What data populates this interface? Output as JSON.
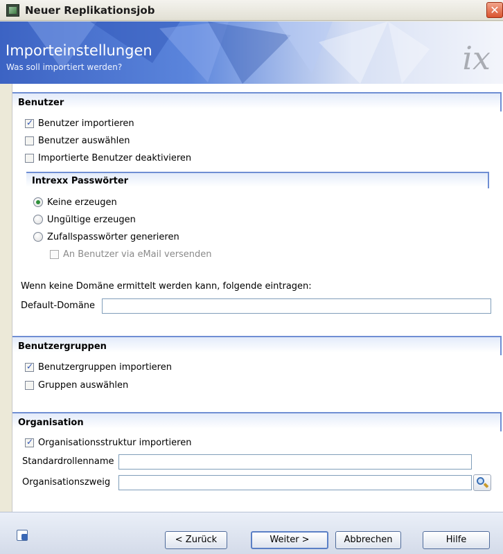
{
  "window": {
    "title": "Neuer Replikationsjob",
    "close_glyph": "✕"
  },
  "banner": {
    "title": "Importeinstellungen",
    "subtitle": "Was soll importiert werden?",
    "logo_text": "ix"
  },
  "benutzer": {
    "header": "Benutzer",
    "items": [
      {
        "label": "Benutzer importieren",
        "checked": true
      },
      {
        "label": "Benutzer auswählen",
        "checked": false
      },
      {
        "label": "Importierte Benutzer deaktivieren",
        "checked": false
      }
    ],
    "passwords": {
      "header": "Intrexx Passwörter",
      "options": [
        {
          "label": "Keine erzeugen",
          "selected": true
        },
        {
          "label": "Ungültige erzeugen",
          "selected": false
        },
        {
          "label": "Zufallspasswörter generieren",
          "selected": false
        }
      ],
      "email_option": {
        "label": "An Benutzer via eMail versenden",
        "checked": false,
        "enabled": false
      }
    },
    "domain_hint": "Wenn keine Domäne ermittelt werden kann, folgende eintragen:",
    "default_domain_label": "Default-Domäne",
    "default_domain_value": ""
  },
  "benutzergruppen": {
    "header": "Benutzergruppen",
    "items": [
      {
        "label": "Benutzergruppen importieren",
        "checked": true
      },
      {
        "label": "Gruppen auswählen",
        "checked": false
      }
    ]
  },
  "organisation": {
    "header": "Organisation",
    "import_label": "Organisationsstruktur importieren",
    "import_checked": true,
    "role_label": "Standardrollenname",
    "role_value": "",
    "branch_label": "Organisationszweig",
    "branch_value": ""
  },
  "footer": {
    "back": "< Zurück",
    "next": "Weiter >",
    "cancel": "Abbrechen",
    "help": "Hilfe"
  },
  "colors": {
    "accent": "#6f8ed3",
    "banner": "#3c63c3",
    "checkmark": "#2c52b3",
    "radio_dot": "#2e8f3a"
  }
}
